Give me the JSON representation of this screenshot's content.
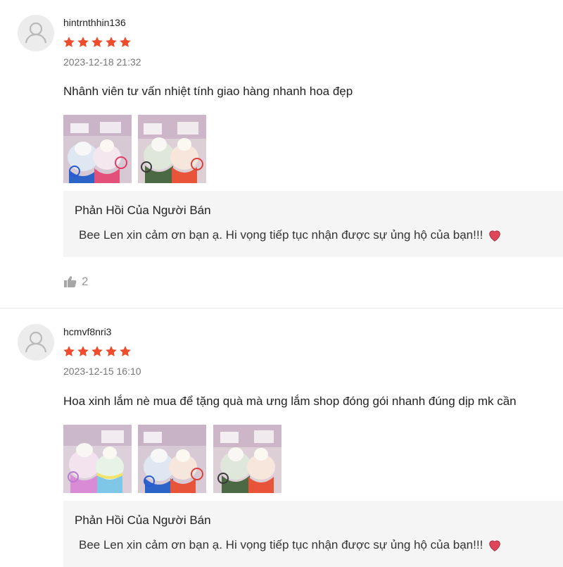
{
  "colors": {
    "star": "#ee4d2d",
    "heart": "#e0465a",
    "reply_bg": "#f5f5f5"
  },
  "reviews": [
    {
      "username": "hintrnthhin136",
      "rating": 5,
      "timestamp": "2023-12-18 21:32",
      "comment": "Nhânh viên tư vấn nhiệt tính giao hàng nhanh hoa đẹp",
      "reply_title": "Phản Hồi Của Người Bán",
      "reply_text": "Bee Len xin cảm ơn bạn ạ. Hi vọng tiếp tục nhận được sự ủng hộ của bạn!!!",
      "reply_emoji": "heart-icon",
      "likes": "2"
    },
    {
      "username": "hcmvf8nri3",
      "rating": 5,
      "timestamp": "2023-12-15 16:10",
      "comment": "Hoa xinh lắm nè mua để tặng quà mà ưng lắm shop đóng gói nhanh đúng dịp mk cần",
      "reply_title": "Phản Hồi Của Người Bán",
      "reply_text": "Bee Len xin cảm ơn bạn ạ. Hi vọng tiếp tục nhận được sự ủng hộ của bạn!!!",
      "reply_emoji": "heart-icon"
    }
  ]
}
